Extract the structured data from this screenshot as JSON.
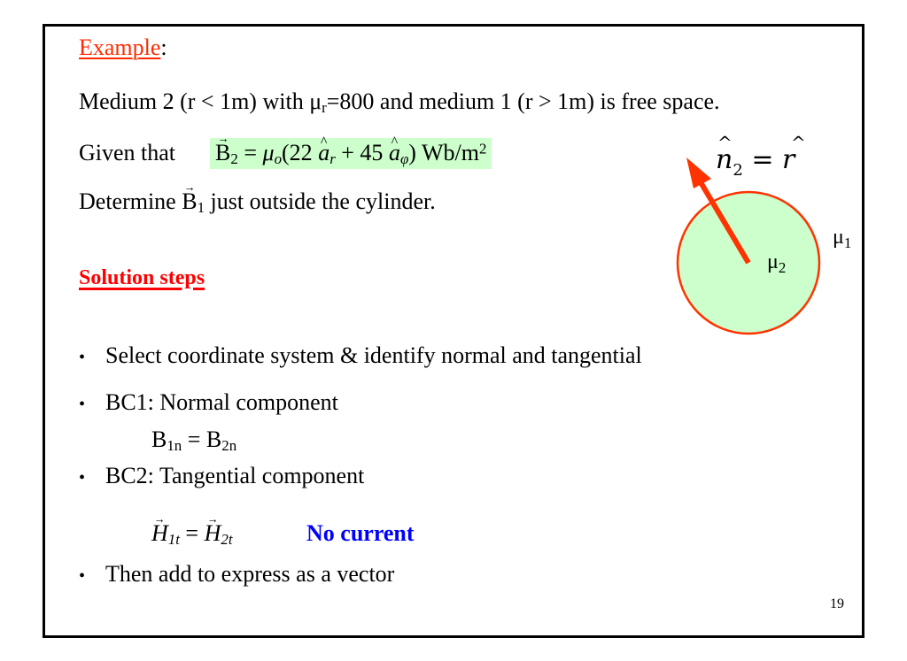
{
  "slide": {
    "title": "Example",
    "title_suffix": ":",
    "problem": {
      "line1": "Medium 2 (r < 1m) with μ",
      "line1_sub": "r",
      "line1_rest": "=800 and medium 1 (r > 1m) is free space.",
      "given_label": "Given that",
      "given_eq": {
        "lhs_symbol": "B",
        "lhs_sub": "2",
        "equals": "=",
        "mu": "μ",
        "mu_sub": "o",
        "open": "(22 ",
        "ar": "a",
        "ar_sub": "r",
        "plus": " +  45 ",
        "aphi": "a",
        "aphi_sub": "φ",
        "close": ") Wb/m",
        "unit_sup": "2"
      },
      "determine_label": "Determine",
      "determine_symbol": "B",
      "determine_sub": "1",
      "determine_rest": "just outside the cylinder."
    },
    "solution_heading": "Solution steps",
    "steps": [
      {
        "bullet": "•",
        "text": "Select coordinate system & identify normal and tangential"
      },
      {
        "bullet": "•",
        "text": "BC1: Normal component"
      },
      {
        "bullet": "•",
        "text": "BC2: Tangential component"
      },
      {
        "bullet": "•",
        "text": "Then add to express as a vector"
      }
    ],
    "bc1_eq": {
      "lhs": "B",
      "lhs_sub": "1n",
      "eq": " = ",
      "rhs": "B",
      "rhs_sub": "2n"
    },
    "bc2_eq": {
      "lhs": "H",
      "lhs_sub": "1t",
      "eq": " = ",
      "rhs": "H",
      "rhs_sub": "2t"
    },
    "bc2_note": "No current",
    "page_number": "19",
    "diagram": {
      "normal_label": "n",
      "normal_sub": "2",
      "normal_eq": " = ",
      "normal_rhs": "r",
      "outer_medium": "μ",
      "outer_medium_sub": "1",
      "inner_medium": "μ",
      "inner_medium_sub": "2",
      "colors": {
        "circle_fill": "#ccffcc",
        "circle_stroke": "#ff3300",
        "arrow": "#ff3300"
      }
    },
    "colors": {
      "title": "#ff2a00",
      "solution_heading": "#ff0000",
      "note": "#0000ff",
      "highlight": "#ccffcc"
    }
  }
}
